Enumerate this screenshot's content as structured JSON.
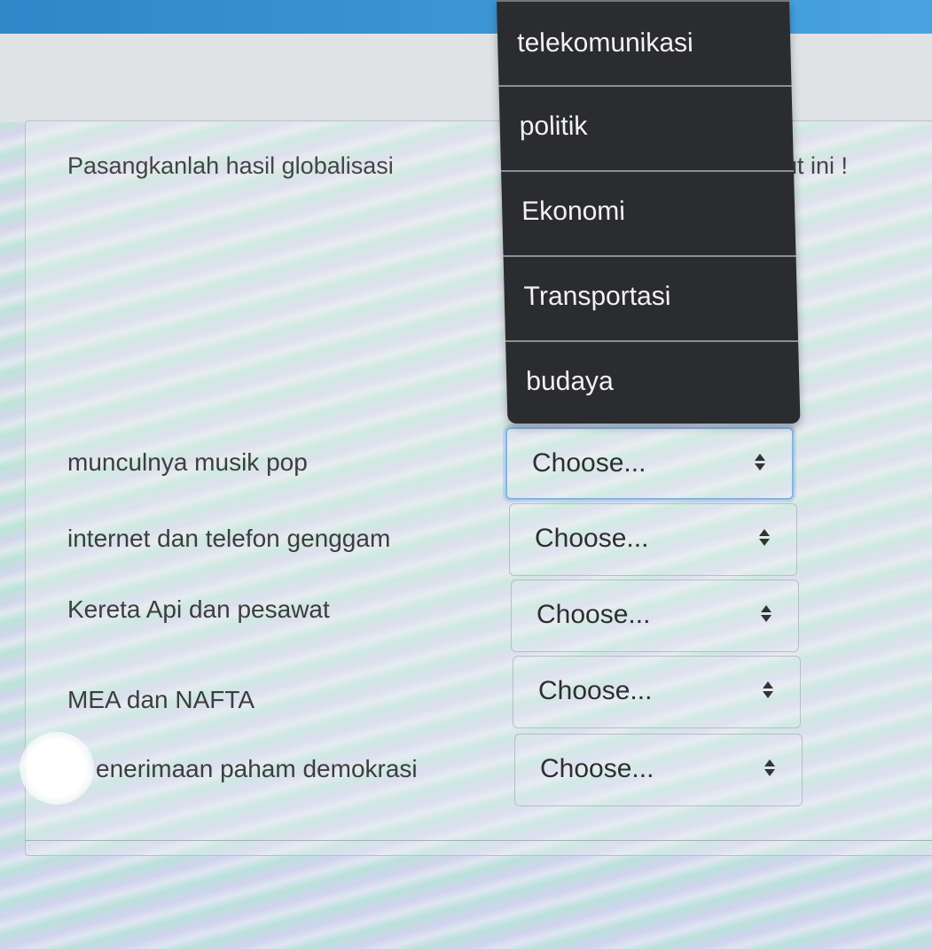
{
  "question": {
    "text_visible_left": "Pasangkanlah hasil globalisasi",
    "text_visible_right": "ut ini !"
  },
  "dropdown": {
    "open": true,
    "options": [
      {
        "label": "telekomunikasi"
      },
      {
        "label": "politik"
      },
      {
        "label": "Ekonomi"
      },
      {
        "label": "Transportasi"
      },
      {
        "label": "budaya"
      }
    ]
  },
  "rows": [
    {
      "label": "munculnya musik pop",
      "select_value": "Choose...",
      "focused": true
    },
    {
      "label": "internet dan telefon genggam",
      "select_value": "Choose...",
      "focused": false
    },
    {
      "label": "Kereta Api dan pesawat",
      "select_value": "Choose...",
      "focused": false
    },
    {
      "label": "MEA dan NAFTA",
      "select_value": "Choose...",
      "focused": false
    },
    {
      "label": "enerimaan paham demokrasi",
      "select_value": "Choose...",
      "focused": false
    }
  ],
  "colors": {
    "topbar": "#3a93d6",
    "dropdown_bg": "#2b2c2f",
    "focus_ring": "#86b2e6"
  }
}
